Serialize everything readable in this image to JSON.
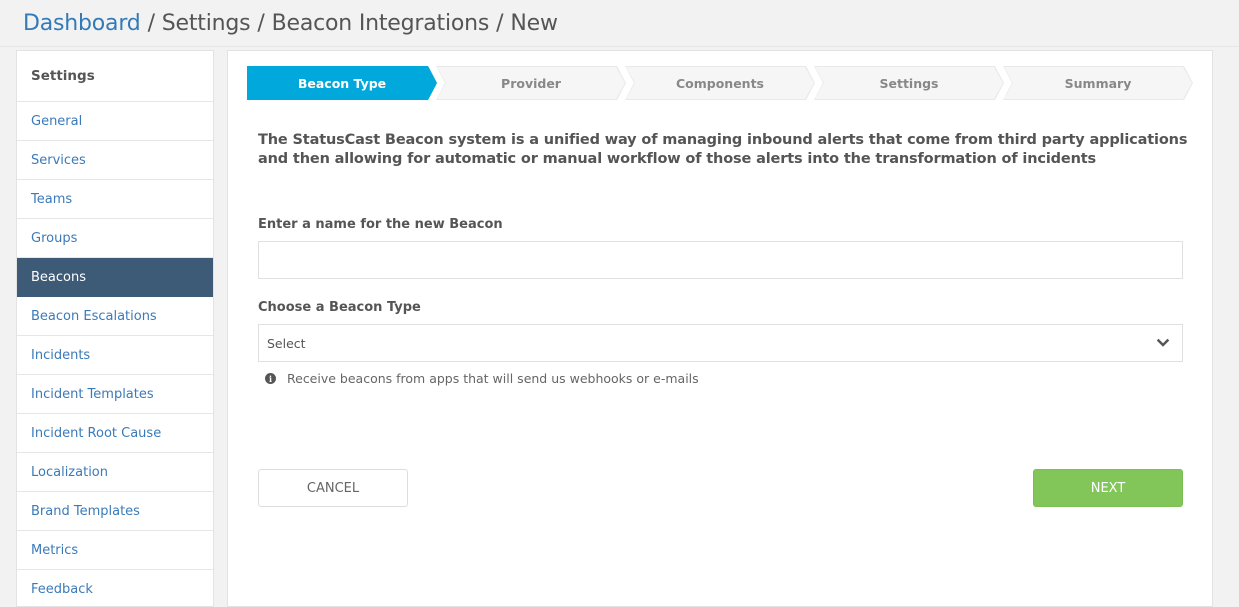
{
  "breadcrumb": {
    "items": [
      {
        "label": "Dashboard",
        "link": true
      },
      {
        "label": "Settings",
        "link": false
      },
      {
        "label": "Beacon Integrations",
        "link": false
      },
      {
        "label": "New",
        "link": false
      }
    ],
    "separator": "/"
  },
  "sidebar": {
    "title": "Settings",
    "active_index": 4,
    "items": [
      {
        "label": "General"
      },
      {
        "label": "Services"
      },
      {
        "label": "Teams"
      },
      {
        "label": "Groups"
      },
      {
        "label": "Beacons"
      },
      {
        "label": "Beacon Escalations"
      },
      {
        "label": "Incidents"
      },
      {
        "label": "Incident Templates"
      },
      {
        "label": "Incident Root Cause"
      },
      {
        "label": "Localization"
      },
      {
        "label": "Brand Templates"
      },
      {
        "label": "Metrics"
      },
      {
        "label": "Feedback"
      }
    ]
  },
  "wizard": {
    "active_step": 0,
    "steps": [
      {
        "label": "Beacon Type"
      },
      {
        "label": "Provider"
      },
      {
        "label": "Components"
      },
      {
        "label": "Settings"
      },
      {
        "label": "Summary"
      }
    ],
    "colors": {
      "active": "#00a8dc",
      "inactive": "#f6f6f6"
    }
  },
  "form": {
    "intro": "The StatusCast Beacon system is a unified way of managing inbound alerts that come from third party applications and then allowing for automatic or manual workflow of those alerts into the transformation of incidents",
    "name_label": "Enter a name for the new Beacon",
    "name_value": "",
    "type_label": "Choose a Beacon Type",
    "type_selected": "Select",
    "hint_icon": "info-circle-icon",
    "hint": "Receive beacons from apps that will send us webhooks or e-mails"
  },
  "buttons": {
    "cancel": "CANCEL",
    "next": "NEXT",
    "next_color": "#82c65a"
  }
}
